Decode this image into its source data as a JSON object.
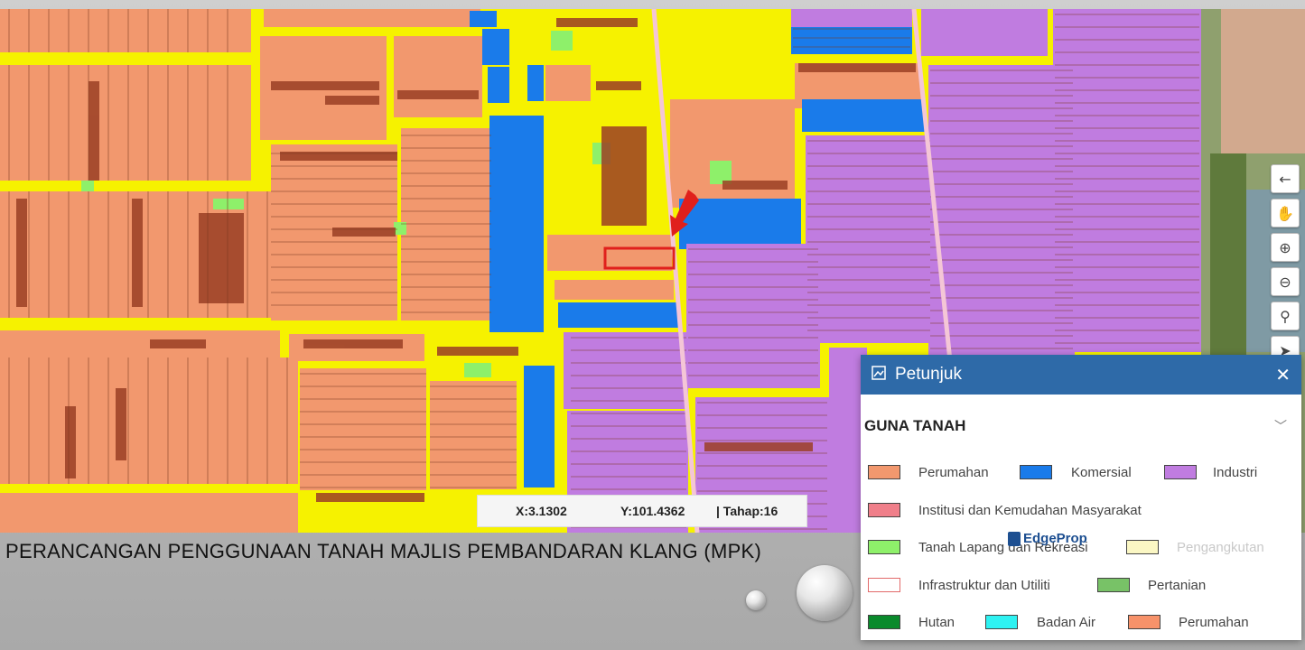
{
  "map": {
    "colors": {
      "road": "#f6f200",
      "perumahan": "#f2986e",
      "komersial": "#1a7bea",
      "industri": "#c07ce0",
      "green": "#8ef06a",
      "pink_line": "#f4c6d6",
      "marker": "#e0201c"
    },
    "toolbar": [
      {
        "name": "back-arrow-icon",
        "glyph": "←"
      },
      {
        "name": "pan-hand-icon",
        "glyph": "✋"
      },
      {
        "name": "zoom-in-icon",
        "glyph": "⊕"
      },
      {
        "name": "zoom-out-icon",
        "glyph": "⊖"
      },
      {
        "name": "person-location-icon",
        "glyph": "⚲"
      },
      {
        "name": "navigate-arrow-icon",
        "glyph": "➤"
      }
    ]
  },
  "coords": {
    "x": "X:3.1302",
    "y": "Y:101.4362",
    "level": "| Tahap:16"
  },
  "caption": "PERANCANGAN PENGGUNAAN TANAH MAJLIS PEMBANDARAN KLANG (MPK)",
  "brand": "EdgeProp",
  "legend": {
    "title": "Petunjuk",
    "section": "GUNA TANAH",
    "rows": [
      [
        {
          "label": "Perumahan",
          "color": "#f2986e"
        },
        {
          "label": "Komersial",
          "color": "#1a7bea"
        },
        {
          "label": "Industri",
          "color": "#c07ce0"
        }
      ],
      [
        {
          "label": "Institusi dan Kemudahan Masyarakat",
          "color": "#f07f8a"
        }
      ],
      [
        {
          "label": "Tanah Lapang dan Rekreasi",
          "color": "#8ef06a"
        },
        {
          "label": "Pengangkutan",
          "color": "#fbf7c4"
        }
      ],
      [
        {
          "label": "Infrastruktur dan Utiliti",
          "color": "#ffffff",
          "border": "#e26a6a"
        },
        {
          "label": "Pertanian",
          "color": "#78c267"
        }
      ],
      [
        {
          "label": "Hutan",
          "color": "#0a8a2c"
        },
        {
          "label": "Badan Air",
          "color": "#2ef2f2"
        },
        {
          "label": "Perumahan",
          "color": "#f7926a"
        }
      ]
    ]
  }
}
